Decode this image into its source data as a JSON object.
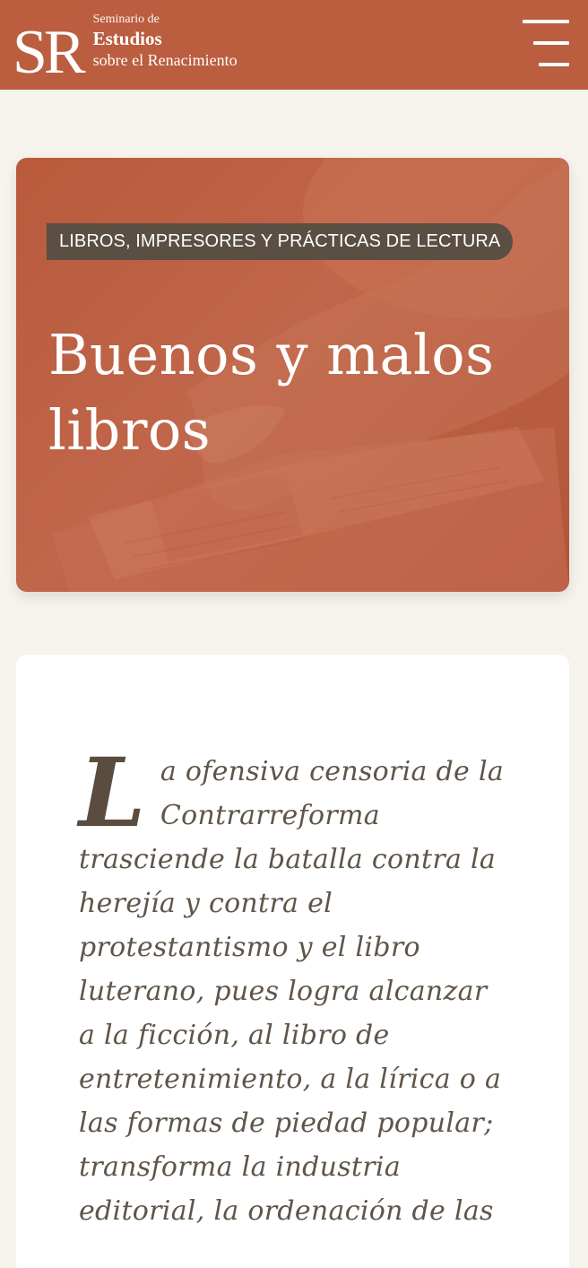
{
  "header": {
    "logo_mark": "SR",
    "logo_line1": "Seminario de",
    "logo_line2": "Estudios",
    "logo_line3": "sobre el Renacimiento",
    "brand_color": "#bb5d3f"
  },
  "hero": {
    "category_tag": "LIBROS, IMPRESORES Y PRÁCTICAS DE LECTURA",
    "title": "Buenos y malos libros"
  },
  "article": {
    "drop_cap": "L",
    "body": "a ofensiva censoria de la Contrarreforma trasciende la batalla contra la herejía y contra el protestantismo y el libro luterano, pues logra alcanzar a la ficción, al libro de entretenimiento, a la lírica o a las formas de piedad popular; transforma la industria editorial, la ordenación de las"
  }
}
